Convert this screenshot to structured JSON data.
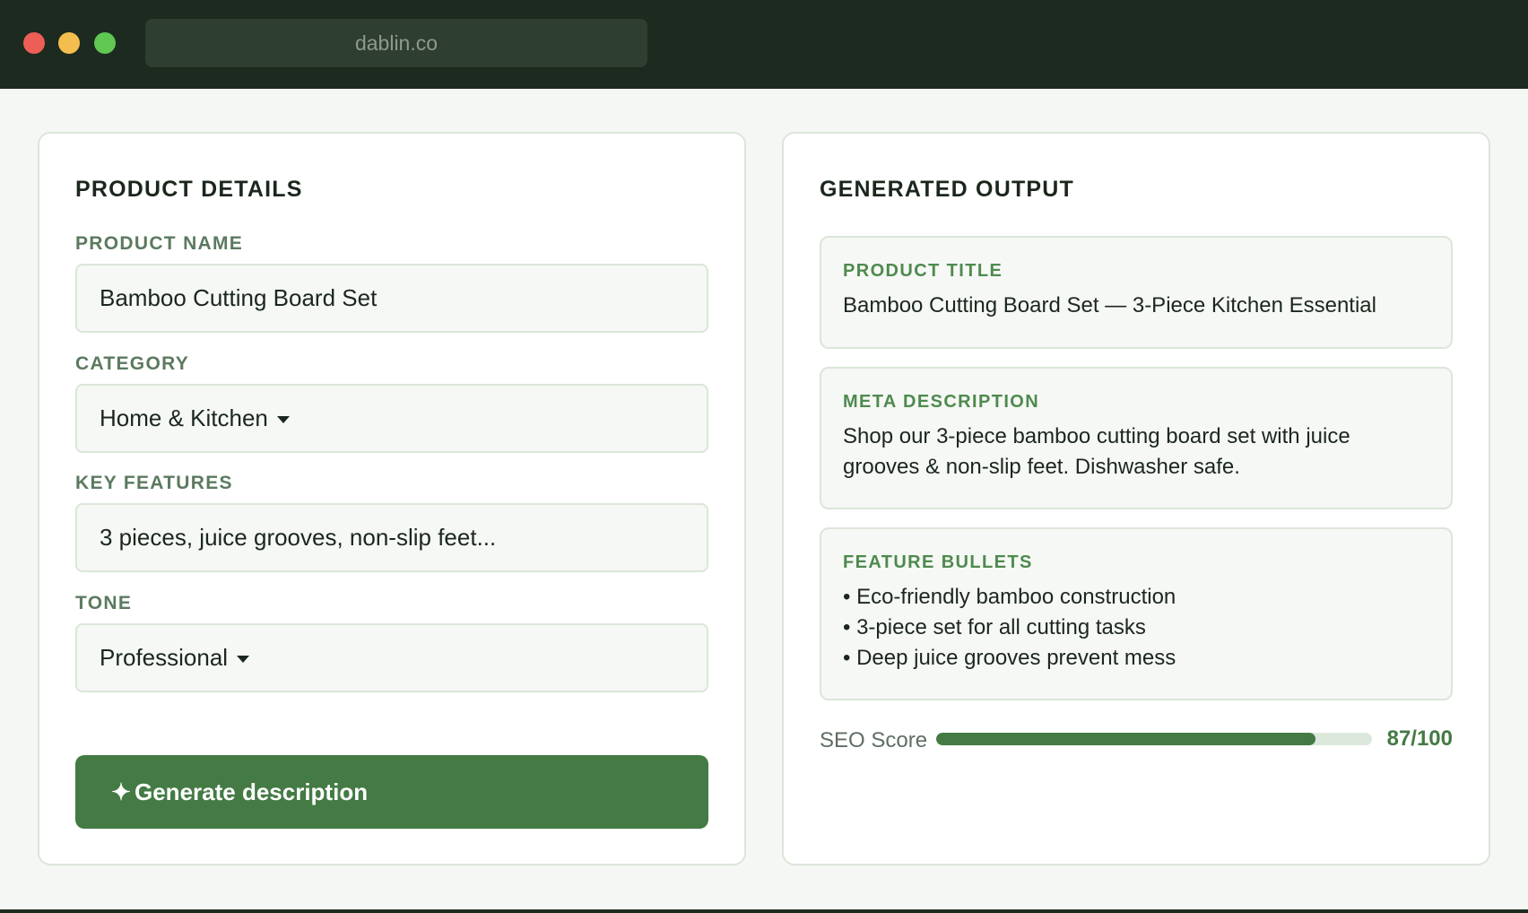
{
  "browser": {
    "url": "dablin.co"
  },
  "product_details": {
    "title": "PRODUCT DETAILS",
    "name": {
      "label": "PRODUCT NAME",
      "value": "Bamboo Cutting Board Set"
    },
    "category": {
      "label": "CATEGORY",
      "value": "Home & Kitchen"
    },
    "features": {
      "label": "KEY FEATURES",
      "value": "3 pieces, juice grooves, non-slip feet..."
    },
    "tone": {
      "label": "TONE",
      "value": "Professional"
    },
    "generate_button": {
      "icon": "sparkle-icon",
      "symbol": "✦",
      "label": "Generate description"
    }
  },
  "generated_output": {
    "title": "GENERATED OUTPUT",
    "product_title": {
      "label": "PRODUCT TITLE",
      "text": "Bamboo Cutting Board Set — 3-Piece Kitchen Essential"
    },
    "meta_description": {
      "label": "META DESCRIPTION",
      "text": "Shop our 3-piece bamboo cutting board set with juice grooves & non-slip feet. Dishwasher safe."
    },
    "feature_bullets": {
      "label": "FEATURE BULLETS",
      "items": [
        "Eco-friendly bamboo construction",
        "3-piece set for all cutting tasks",
        "Deep juice grooves prevent mess"
      ]
    },
    "seo": {
      "label": "SEO Score",
      "value": 87,
      "max": 100,
      "display": "87/100"
    }
  },
  "colors": {
    "accent": "#447a44",
    "titlebar": "#1d2a1f",
    "background": "#f4f7f3",
    "label": "#5b7a5f"
  }
}
